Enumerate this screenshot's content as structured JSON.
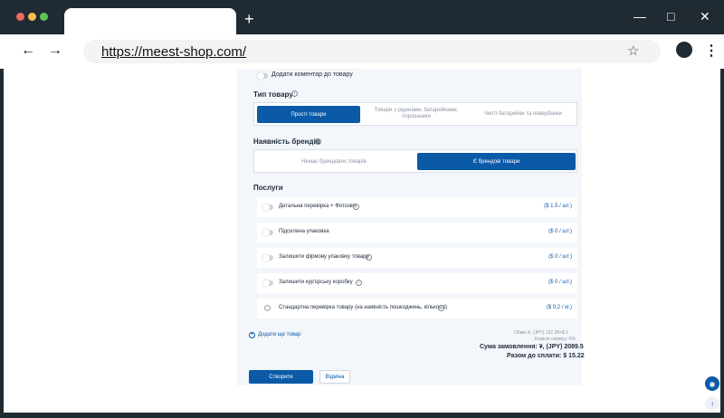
{
  "browser": {
    "url": "https://meest-shop.com/",
    "new_tab": "+",
    "back": "←",
    "forward": "→",
    "bookmark": "☆",
    "menu": "⋮"
  },
  "form": {
    "comment_toggle_label": "Додати коментар до товару",
    "product_type_title": "Тип товару",
    "product_type_options": [
      "Прості товари",
      "Товари з рідинами, батарейками, порошками",
      "Чисті батарейки та повербанки"
    ],
    "brand_title": "Наявність брендів",
    "brand_options": [
      "Немає брендових товарів",
      "Є брендові товари"
    ],
    "services_title": "Послуги",
    "services": [
      {
        "label": "Детальна перевірка + Фотозвіт",
        "price": "($ 1.5 / шт.)"
      },
      {
        "label": "Підсилена упаковка",
        "price": "($ 0 / шт.)"
      },
      {
        "label": "Залишити фірмову упаковку товару",
        "price": "($ 0 / шт.)"
      },
      {
        "label": "Залишити кур'єрську коробку",
        "price": "($ 0 / шт.)"
      },
      {
        "label": "Стандартна перевірка товару (на наявність пошкоджень, кількості)",
        "price": "($ 0,2 / кг.)"
      }
    ],
    "add_item": "Додати ще товар",
    "exchange_rate": "Обмін ¥, (JPY) 137.28=$ 1",
    "commission": "Комісія сервісу: 5%",
    "order_sum": "Сума замовлення: ¥, (JPY) 2089.5",
    "pay_total": "Разом до сплати: $ 15.22",
    "create_button": "Створити",
    "cancel_button": "Відміна"
  },
  "colors": {
    "accent": "#0a5aa8",
    "panel": "#f3f6fa"
  }
}
